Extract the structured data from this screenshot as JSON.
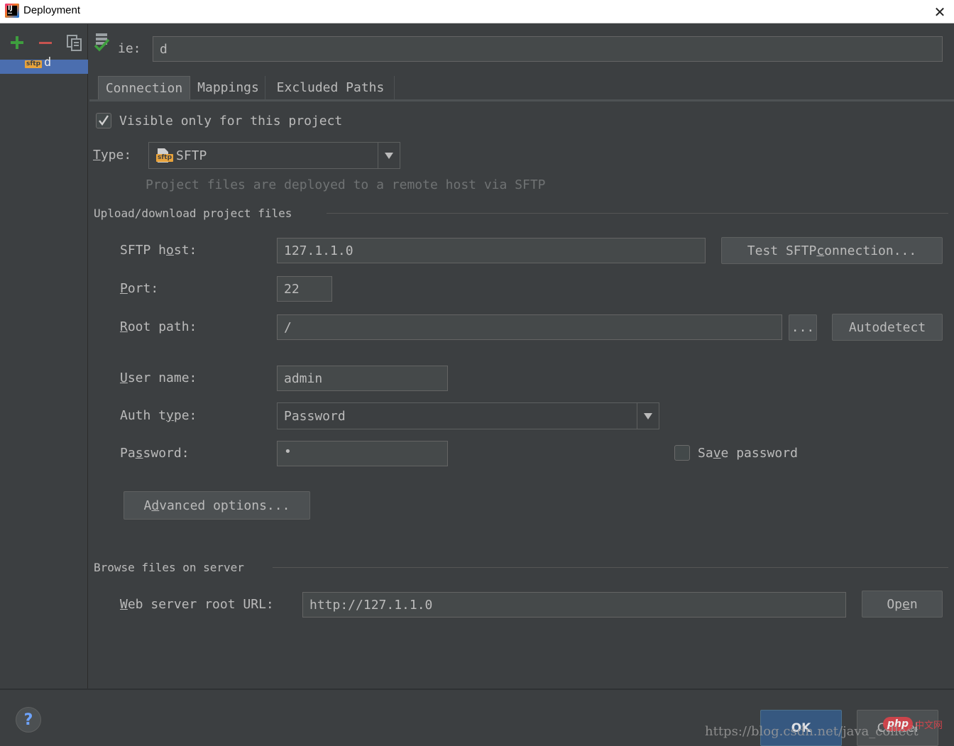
{
  "window": {
    "title": "Deployment",
    "close_glyph": "✕"
  },
  "toolbar": {
    "icons": [
      "add-icon",
      "remove-icon",
      "copy-icon",
      "set-default-icon"
    ]
  },
  "server_list": {
    "items": [
      {
        "badge": "sftp",
        "label": "d"
      }
    ]
  },
  "name": {
    "label": "ie:",
    "value": "d"
  },
  "tabs": [
    {
      "label": "Connection",
      "selected": true
    },
    {
      "label": "Mappings"
    },
    {
      "label": "Excluded Paths"
    }
  ],
  "connection": {
    "visible_only_label": "Visible only for this project",
    "visible_only_checked": true,
    "type_label": "Type:",
    "type_value": "SFTP",
    "type_badge": "sftp",
    "type_hint": "Project files are deployed to a remote host via SFTP",
    "upload_section": "Upload/download project files",
    "host_label": "SFTP host:",
    "host_value": "127.1.1.0",
    "test_button": "Test SFTP connection...",
    "port_label": "Port:",
    "port_value": "22",
    "root_label": "Root path:",
    "root_value": "/",
    "browse_button": "...",
    "autodetect_button": "Autodetect",
    "user_label": "User name:",
    "user_value": "admin",
    "auth_label": "Auth type:",
    "auth_value": "Password",
    "password_label": "Password:",
    "password_value": "•",
    "save_password_label": "Save password",
    "save_password_checked": false,
    "advanced_button": "Advanced options...",
    "browse_section": "Browse files on server",
    "web_url_label": "Web server root URL:",
    "web_url_value": "http://127.1.1.0",
    "open_button": "Open"
  },
  "footer": {
    "help_glyph": "?",
    "ok_button": "OK",
    "cancel_button": "Cancel"
  },
  "watermark": {
    "url": "https://blog.csdn.net/java_collect",
    "logo": "php 中文网"
  },
  "colors": {
    "background": "#3c3f41",
    "field": "#45494a",
    "selection": "#4b6eaf",
    "add": "#3e9e3e",
    "remove": "#c75450"
  }
}
